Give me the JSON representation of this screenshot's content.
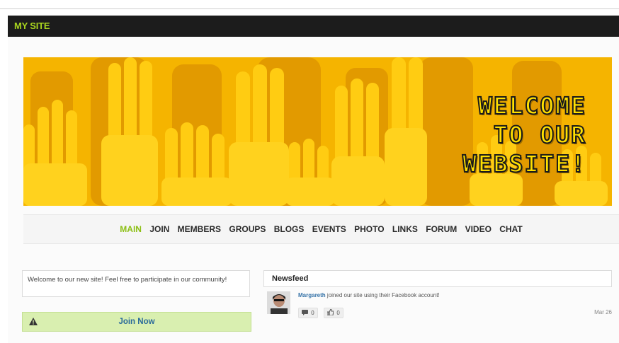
{
  "header": {
    "site_title": "MY SITE"
  },
  "banner": {
    "lines": [
      "WELCOME",
      "TO OUR",
      "WEBSITE!"
    ]
  },
  "nav": {
    "items": [
      {
        "label": "MAIN",
        "active": true
      },
      {
        "label": "JOIN"
      },
      {
        "label": "MEMBERS"
      },
      {
        "label": "GROUPS"
      },
      {
        "label": "BLOGS"
      },
      {
        "label": "EVENTS"
      },
      {
        "label": "PHOTO"
      },
      {
        "label": "LINKS"
      },
      {
        "label": "FORUM"
      },
      {
        "label": "VIDEO"
      },
      {
        "label": "CHAT"
      }
    ],
    "active_color": "#8cbf14"
  },
  "sidebar": {
    "welcome_text": "Welcome to our new site! Feel free to participate in our community!",
    "join_label": "Join Now",
    "join_icon": "warning-icon"
  },
  "newsfeed": {
    "title": "Newsfeed",
    "item": {
      "user": "Margareth",
      "text": "joined our site using their Facebook account!",
      "comments": "0",
      "likes": "0",
      "date": "Mar 26"
    }
  },
  "colors": {
    "topbar": "#1c1c1c",
    "brand_green": "#a9d51f",
    "banner_yellow": "#f7b500",
    "join_bg": "#d9efb0",
    "link_blue": "#3673a8"
  }
}
